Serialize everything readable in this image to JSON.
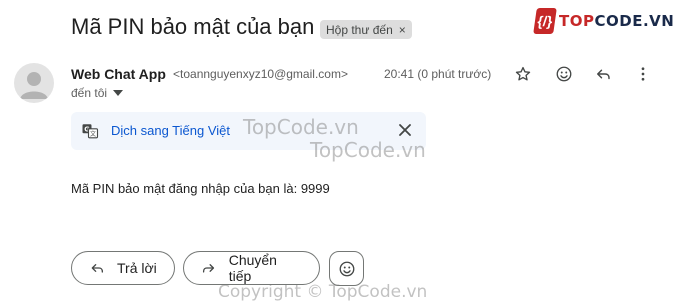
{
  "email": {
    "subject": "Mã PIN bảo mật của bạn",
    "label": "Hộp thư đến",
    "label_close": "×",
    "sender_name": "Web Chat App",
    "sender_email": "<toannguyenxyz10@gmail.com>",
    "time": "20:41 (0 phút trước)",
    "recipient": "đến tôi",
    "translate_link": "Dịch sang Tiếng Việt",
    "body": "Mã PIN bảo mật đăng nhập của bạn là: 9999"
  },
  "actions": {
    "reply_label": "Trả lời",
    "forward_label": "Chuyển tiếp"
  },
  "logo": {
    "mark": "{/}",
    "text_prefix": "TOP",
    "text_suffix": "CODE.VN"
  },
  "watermarks": {
    "primary": "TopCode.vn",
    "secondary": "TopCode.vn",
    "copyright": "Copyright © TopCode.vn"
  },
  "icons": [
    "star-icon",
    "emoji-icon",
    "reply-icon",
    "more-vert-icon",
    "translate-icon",
    "close-icon",
    "chevron-down-icon",
    "forward-icon",
    "avatar-icon"
  ]
}
